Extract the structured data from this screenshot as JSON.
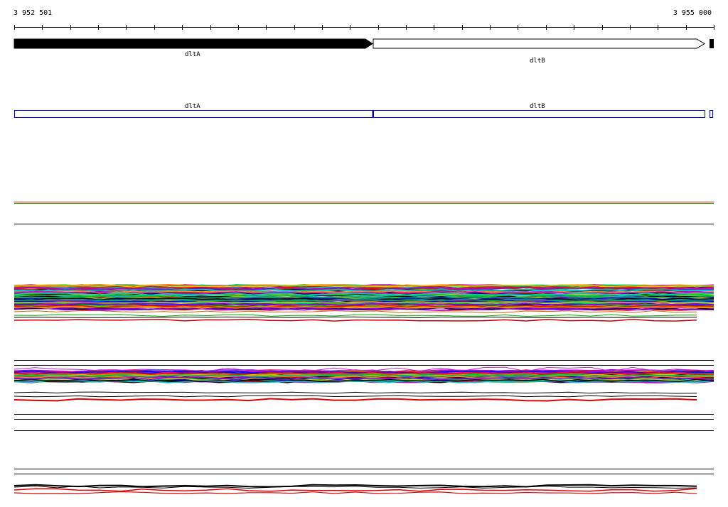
{
  "ruler": {
    "start_label": "3 952 501",
    "end_label": "3 955 000"
  },
  "genes": [
    {
      "name": "dltA",
      "style": "filled"
    },
    {
      "name": "dltB",
      "style": "outline"
    }
  ],
  "transcripts": [
    {
      "name": "dltA",
      "color": "#0000cc"
    },
    {
      "name": "dltB",
      "color": "#0000cc"
    }
  ],
  "palette": [
    "#00cc00",
    "#cc00cc",
    "#0000ff",
    "#ff0000",
    "#00cccc",
    "#cccc00",
    "#000000",
    "#ff8800",
    "#8800ff",
    "#00aa66"
  ],
  "accent_colors": {
    "gene_fill": "#000000",
    "transcript_stroke": "#0000cc",
    "highlight_track": "#dd0000"
  }
}
